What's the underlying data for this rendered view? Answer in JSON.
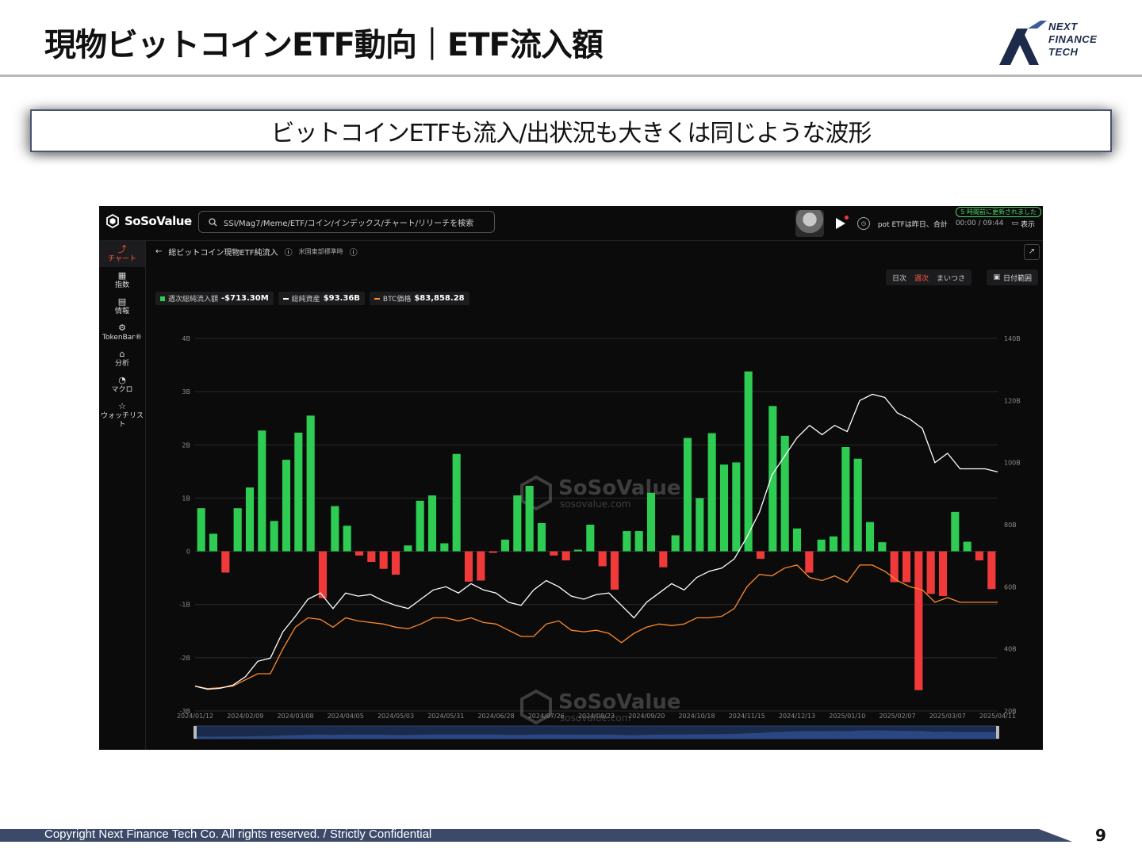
{
  "slide": {
    "title": "現物ビットコインETF動向｜ETF流入額",
    "subtitle": "ビットコインETFも流入/出状況も大きくは同じような波形",
    "logo": {
      "line1": "NEXT",
      "line2": "FINANCE",
      "line3": "TECH"
    },
    "footer": "Copyright Next Finance Tech Co. All rights reserved. / Strictly Confidential",
    "page_number": "9"
  },
  "app": {
    "brand": "SoSoValue",
    "search_placeholder": "SSI/Mag7/Meme/ETF/コイン/インデックス/チャート/リリーチを検索",
    "update_badge": "5 時間前に更新されました",
    "ticker_text": "pot ETFは昨日、合計",
    "time": "00:00 / 09:44",
    "show_label": "表示",
    "sidebar": [
      {
        "icon": "chart-icon",
        "label": "チャート",
        "active": true
      },
      {
        "icon": "index-icon",
        "label": "指数",
        "badge": "NEW"
      },
      {
        "icon": "news-icon",
        "label": "情報"
      },
      {
        "icon": "tokenbar-icon",
        "label": "TokenBar®"
      },
      {
        "icon": "analysis-icon",
        "label": "分析"
      },
      {
        "icon": "macro-icon",
        "label": "マクロ"
      },
      {
        "icon": "watchlist-icon",
        "label": "ウォッチリスト"
      }
    ],
    "breadcrumb_title": "総ビットコイン現物ETF純流入",
    "breadcrumb_sub": "米国東部標準時",
    "periods": {
      "day": "日次",
      "week": "週次",
      "month": "まいつさ"
    },
    "date_range_label": "日付範囲",
    "legend": [
      {
        "label": "週次総純流入額",
        "value": "-$713.30M",
        "color": "#2ecc52"
      },
      {
        "label": "総純資産",
        "value": "$93.36B",
        "color": "#ffffff"
      },
      {
        "label": "BTC価格",
        "value": "$83,858.28",
        "color": "#ff8a2a"
      }
    ],
    "watermark_brand": "SoSoValue",
    "watermark_url": "sosovalue.com"
  },
  "chart_data": {
    "type": "bar",
    "left_axis": {
      "ticks": [
        "4B",
        "3B",
        "2B",
        "1B",
        "0",
        "-1B",
        "-2B",
        "-3B"
      ],
      "ylim": [
        -3,
        4
      ],
      "unit": "B USD"
    },
    "right_axis": {
      "ticks": [
        "140B",
        "120B",
        "100B",
        "80B",
        "60B",
        "40B",
        "20B"
      ],
      "ylim": [
        20,
        140
      ],
      "unit": "B USD"
    },
    "x_tick_labels": [
      "2024/01/12",
      "2024/02/09",
      "2024/03/08",
      "2024/04/05",
      "2024/05/03",
      "2024/05/31",
      "2024/06/28",
      "2024/07/26",
      "2024/08/23",
      "2024/09/20",
      "2024/10/18",
      "2024/11/15",
      "2024/12/13",
      "2025/01/10",
      "2025/02/07",
      "2025/03/07",
      "2025/04/11"
    ],
    "colors": {
      "inflow": "#2ecc52",
      "outflow": "#f03a3a",
      "net_assets": "#ffffff",
      "btc_price": "#ff8a2a"
    },
    "series": [
      {
        "name": "週次総純流入額",
        "kind": "bar",
        "axis": "left",
        "values": [
          0.81,
          0.33,
          -0.4,
          0.81,
          1.2,
          2.27,
          0.57,
          1.72,
          2.23,
          2.55,
          -0.88,
          0.85,
          0.48,
          -0.08,
          -0.2,
          -0.33,
          -0.44,
          0.11,
          0.95,
          1.05,
          0.15,
          1.83,
          -0.57,
          -0.55,
          -0.03,
          0.22,
          1.05,
          1.23,
          0.53,
          -0.08,
          -0.17,
          0.03,
          0.5,
          -0.28,
          -0.72,
          0.38,
          0.38,
          1.1,
          -0.3,
          0.3,
          2.13,
          1.0,
          2.22,
          1.63,
          1.67,
          3.38,
          -0.14,
          2.73,
          2.17,
          0.43,
          -0.4,
          0.22,
          0.28,
          1.96,
          1.74,
          0.55,
          0.17,
          -0.58,
          -0.58,
          -2.61,
          -0.8,
          -0.84,
          0.74,
          0.18,
          -0.17,
          -0.71
        ]
      },
      {
        "name": "総純資産",
        "kind": "line",
        "axis": "right",
        "values": [
          28.0,
          27.0,
          27.3,
          28.3,
          31.0,
          36.0,
          37.0,
          45.5,
          50.5,
          56.0,
          58.0,
          53.0,
          58.0,
          57.0,
          57.5,
          55.5,
          54.0,
          53.0,
          56.0,
          59.0,
          60.0,
          58.0,
          61.0,
          59.0,
          58.0,
          55.0,
          54.0,
          59.0,
          62.0,
          60.0,
          57.0,
          56.0,
          57.5,
          58.0,
          54.0,
          50.0,
          55.0,
          58.0,
          61.0,
          59.0,
          63.0,
          65.0,
          66.0,
          69.0,
          76.0,
          84.0,
          96.0,
          102.0,
          108.0,
          112.0,
          109.0,
          112.0,
          110.0,
          120.0,
          122.0,
          121.0,
          116.0,
          114.0,
          111.0,
          100.0,
          103.0,
          98.0,
          98.0,
          98.0,
          97.0
        ]
      },
      {
        "name": "BTC価格",
        "kind": "line",
        "axis": "right",
        "values": [
          28.0,
          27.2,
          27.5,
          28.0,
          30.0,
          32.0,
          32.0,
          40.0,
          47.0,
          50.0,
          49.5,
          47.0,
          50.0,
          49.0,
          48.5,
          48.0,
          47.0,
          46.5,
          48.0,
          50.0,
          50.0,
          49.0,
          50.0,
          48.5,
          48.0,
          46.0,
          44.0,
          44.0,
          48.0,
          49.0,
          46.0,
          45.5,
          46.0,
          45.0,
          42.0,
          45.0,
          47.0,
          48.0,
          47.5,
          48.0,
          50.0,
          50.0,
          50.5,
          53.0,
          60.0,
          64.0,
          63.5,
          66.0,
          67.0,
          63.0,
          62.0,
          63.5,
          61.5,
          67.0,
          67.0,
          65.0,
          62.0,
          60.0,
          59.0,
          55.0,
          56.5,
          55.0,
          55.0,
          55.0,
          55.0
        ]
      }
    ]
  }
}
